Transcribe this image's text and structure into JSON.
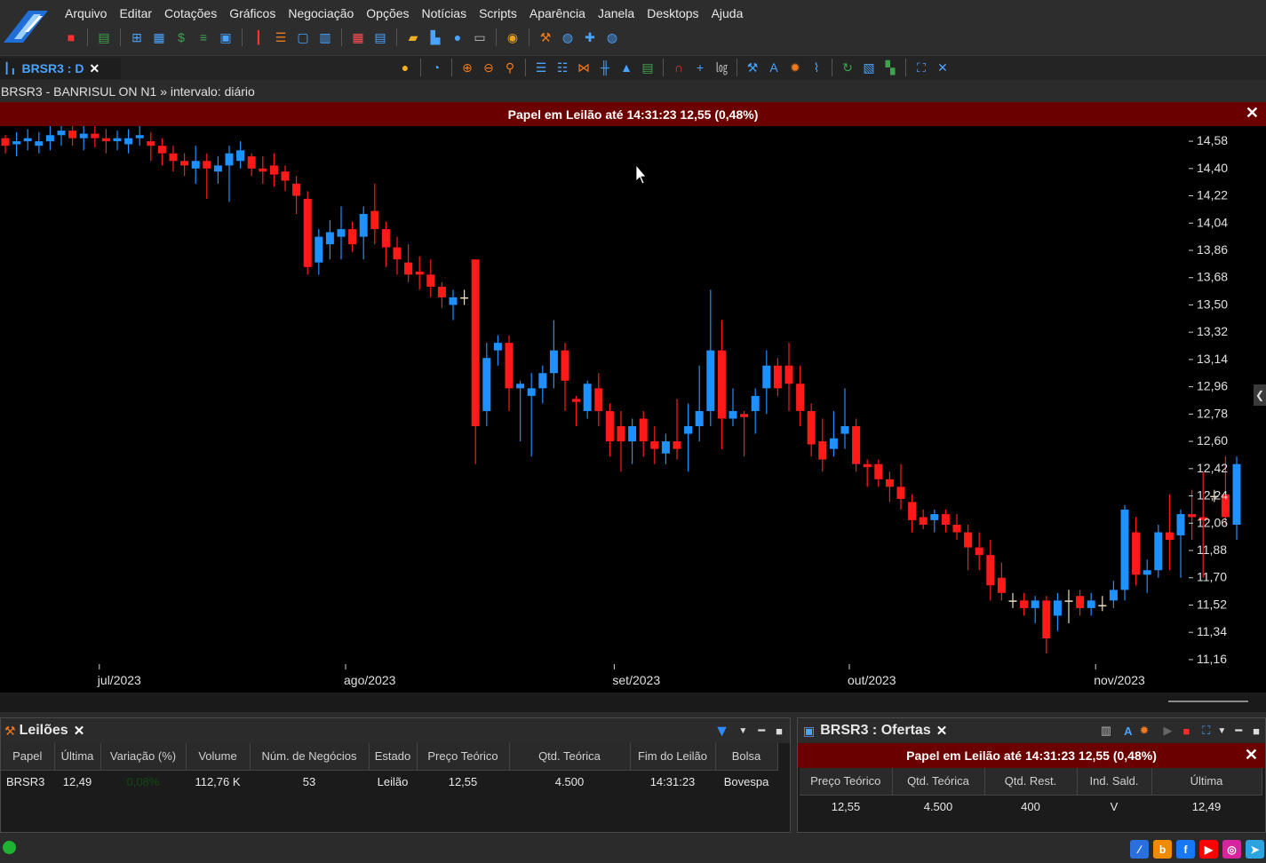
{
  "menu": [
    "Arquivo",
    "Editar",
    "Cotações",
    "Gráficos",
    "Negociação",
    "Opções",
    "Notícias",
    "Scripts",
    "Aparência",
    "Janela",
    "Desktops",
    "Ajuda"
  ],
  "toolbar1_icons": [
    "stop-icon",
    "layout-icon",
    "grid-add-icon",
    "calculator-icon",
    "dollar-icon",
    "ladder-icon",
    "tiles-icon",
    "candles-icon",
    "filter-list-icon",
    "window-icon",
    "list-icon",
    "table-icon",
    "book-icon",
    "folder-icon",
    "bar-chart-icon",
    "person-icon",
    "card-icon",
    "database-stack-icon",
    "hammer-icon",
    "coins-icon",
    "plugin-icon",
    "globe-icon"
  ],
  "toolbar2_icons": [
    "lightbulb-icon",
    "clock-icon",
    "zoom-in-icon",
    "zoom-out-icon",
    "zoom-icon",
    "indicator-list-icon",
    "indicator-add-icon",
    "chart-type-icon",
    "candle-type-icon",
    "shapes-icon",
    "layout-icon",
    "magnet-icon",
    "crosshair-icon",
    "log-scale-icon",
    "wrench-icon",
    "text-a-icon",
    "gear-icon",
    "signals-icon",
    "refresh-icon",
    "image-icon",
    "colors-icon",
    "fit-icon",
    "cross-icon"
  ],
  "chart_tab": {
    "label": "BRSR3 : D",
    "close": "✕"
  },
  "subtitle": "BRSR3 - BANRISUL ON N1 » intervalo: diário",
  "auction_banner": "Papel em Leilão até 14:31:23  12,55 (0,48%)",
  "chart_data": {
    "type": "candlestick",
    "ytick_labels": [
      "14,58",
      "14,40",
      "14,22",
      "14,04",
      "13,86",
      "13,68",
      "13,50",
      "13,32",
      "13,14",
      "12,96",
      "12,78",
      "12,60",
      "12,42",
      "12,24",
      "12,06",
      "11,88",
      "11,70",
      "11,52",
      "11,34",
      "11,16"
    ],
    "ylim": [
      11.06,
      14.68
    ],
    "xtick_labels": [
      "jul/2023",
      "ago/2023",
      "set/2023",
      "out/2023",
      "nov/2023"
    ],
    "xtick_index": [
      8,
      30,
      54,
      75,
      97
    ],
    "up_color": "#1e90ff",
    "down_color": "#ff1a1a",
    "doji_color": "#e8e0c0",
    "candles": [
      [
        14.6,
        14.55,
        14.5,
        14.62
      ],
      [
        14.56,
        14.58,
        14.48,
        14.64
      ],
      [
        14.58,
        14.6,
        14.52,
        14.66
      ],
      [
        14.55,
        14.58,
        14.5,
        14.64
      ],
      [
        14.58,
        14.62,
        14.52,
        14.7
      ],
      [
        14.62,
        14.65,
        14.55,
        14.7
      ],
      [
        14.65,
        14.6,
        14.55,
        14.7
      ],
      [
        14.6,
        14.63,
        14.52,
        14.68
      ],
      [
        14.63,
        14.6,
        14.54,
        14.7
      ],
      [
        14.6,
        14.58,
        14.5,
        14.66
      ],
      [
        14.58,
        14.6,
        14.52,
        14.65
      ],
      [
        14.56,
        14.6,
        14.5,
        14.66
      ],
      [
        14.6,
        14.62,
        14.55,
        14.68
      ],
      [
        14.58,
        14.55,
        14.45,
        14.64
      ],
      [
        14.55,
        14.5,
        14.42,
        14.6
      ],
      [
        14.5,
        14.45,
        14.38,
        14.55
      ],
      [
        14.45,
        14.42,
        14.35,
        14.5
      ],
      [
        14.4,
        14.45,
        14.3,
        14.55
      ],
      [
        14.45,
        14.4,
        14.2,
        14.5
      ],
      [
        14.38,
        14.42,
        14.3,
        14.48
      ],
      [
        14.42,
        14.5,
        14.18,
        14.55
      ],
      [
        14.45,
        14.52,
        14.4,
        14.58
      ],
      [
        14.48,
        14.4,
        14.35,
        14.5
      ],
      [
        14.4,
        14.38,
        14.3,
        14.48
      ],
      [
        14.42,
        14.36,
        14.28,
        14.5
      ],
      [
        14.38,
        14.32,
        14.25,
        14.42
      ],
      [
        14.3,
        14.22,
        14.1,
        14.35
      ],
      [
        14.2,
        13.75,
        13.7,
        14.25
      ],
      [
        13.78,
        13.95,
        13.7,
        14.0
      ],
      [
        13.9,
        13.98,
        13.8,
        14.06
      ],
      [
        13.95,
        14.0,
        13.8,
        14.15
      ],
      [
        14.0,
        13.9,
        13.85,
        14.05
      ],
      [
        13.95,
        14.1,
        13.8,
        14.15
      ],
      [
        14.12,
        14.0,
        13.9,
        14.3
      ],
      [
        14.0,
        13.88,
        13.75,
        14.05
      ],
      [
        13.88,
        13.8,
        13.7,
        13.95
      ],
      [
        13.78,
        13.7,
        13.65,
        13.9
      ],
      [
        13.72,
        13.7,
        13.6,
        13.82
      ],
      [
        13.7,
        13.62,
        13.55,
        13.8
      ],
      [
        13.62,
        13.55,
        13.48,
        13.65
      ],
      [
        13.5,
        13.55,
        13.4,
        13.6
      ],
      [
        13.55,
        13.55,
        13.5,
        13.6
      ],
      [
        13.8,
        12.7,
        12.45,
        13.8
      ],
      [
        12.8,
        13.15,
        12.7,
        13.25
      ],
      [
        13.2,
        13.25,
        13.1,
        13.3
      ],
      [
        13.25,
        12.95,
        12.8,
        13.3
      ],
      [
        12.95,
        12.98,
        12.6,
        13.0
      ],
      [
        12.9,
        12.95,
        12.5,
        13.05
      ],
      [
        12.95,
        13.05,
        12.85,
        13.1
      ],
      [
        13.05,
        13.2,
        12.95,
        13.4
      ],
      [
        13.2,
        13.0,
        12.8,
        13.25
      ],
      [
        12.88,
        12.86,
        12.7,
        12.9
      ],
      [
        12.8,
        12.98,
        12.75,
        13.0
      ],
      [
        12.95,
        12.8,
        12.7,
        13.05
      ],
      [
        12.8,
        12.6,
        12.5,
        12.85
      ],
      [
        12.7,
        12.6,
        12.4,
        12.8
      ],
      [
        12.6,
        12.7,
        12.45,
        12.75
      ],
      [
        12.75,
        12.6,
        12.5,
        12.8
      ],
      [
        12.6,
        12.55,
        12.45,
        12.7
      ],
      [
        12.52,
        12.6,
        12.45,
        12.65
      ],
      [
        12.6,
        12.55,
        12.48,
        12.88
      ],
      [
        12.65,
        12.7,
        12.4,
        12.85
      ],
      [
        12.7,
        12.8,
        12.6,
        13.1
      ],
      [
        12.8,
        13.2,
        12.7,
        13.6
      ],
      [
        13.2,
        12.75,
        12.55,
        13.4
      ],
      [
        12.75,
        12.8,
        12.7,
        12.95
      ],
      [
        12.78,
        12.76,
        12.5,
        12.8
      ],
      [
        12.8,
        12.9,
        12.65,
        12.95
      ],
      [
        12.95,
        13.1,
        12.78,
        13.2
      ],
      [
        13.1,
        12.95,
        12.9,
        13.15
      ],
      [
        13.1,
        12.98,
        12.8,
        13.25
      ],
      [
        12.98,
        12.8,
        12.7,
        13.1
      ],
      [
        12.8,
        12.58,
        12.5,
        12.85
      ],
      [
        12.6,
        12.48,
        12.4,
        12.75
      ],
      [
        12.55,
        12.62,
        12.5,
        12.8
      ],
      [
        12.65,
        12.7,
        12.55,
        12.95
      ],
      [
        12.7,
        12.45,
        12.4,
        12.75
      ],
      [
        12.45,
        12.43,
        12.3,
        12.48
      ],
      [
        12.45,
        12.35,
        12.3,
        12.48
      ],
      [
        12.35,
        12.3,
        12.2,
        12.4
      ],
      [
        12.3,
        12.22,
        12.15,
        12.45
      ],
      [
        12.2,
        12.08,
        12.0,
        12.25
      ],
      [
        12.1,
        12.05,
        12.02,
        12.15
      ],
      [
        12.08,
        12.12,
        12.0,
        12.15
      ],
      [
        12.12,
        12.05,
        12.0,
        12.15
      ],
      [
        12.05,
        12.0,
        11.95,
        12.12
      ],
      [
        12.0,
        11.9,
        11.75,
        12.05
      ],
      [
        11.9,
        11.85,
        11.75,
        12.0
      ],
      [
        11.85,
        11.65,
        11.55,
        11.95
      ],
      [
        11.7,
        11.6,
        11.55,
        11.8
      ],
      [
        11.55,
        11.55,
        11.5,
        11.6
      ],
      [
        11.55,
        11.5,
        11.45,
        11.6
      ],
      [
        11.5,
        11.55,
        11.4,
        11.58
      ],
      [
        11.55,
        11.3,
        11.2,
        11.58
      ],
      [
        11.45,
        11.55,
        11.35,
        11.6
      ],
      [
        11.55,
        11.55,
        11.4,
        11.62
      ],
      [
        11.58,
        11.5,
        11.45,
        11.62
      ],
      [
        11.5,
        11.55,
        11.45,
        11.6
      ],
      [
        11.52,
        11.52,
        11.48,
        11.58
      ],
      [
        11.55,
        11.62,
        11.5,
        11.68
      ],
      [
        11.62,
        12.15,
        11.55,
        12.18
      ],
      [
        12.0,
        11.72,
        11.65,
        12.1
      ],
      [
        11.72,
        11.75,
        11.6,
        11.82
      ],
      [
        11.75,
        12.0,
        11.7,
        12.05
      ],
      [
        12.0,
        11.95,
        11.75,
        12.25
      ],
      [
        11.98,
        12.12,
        11.7,
        12.15
      ],
      [
        12.12,
        12.1,
        11.95,
        12.28
      ],
      [
        12.1,
        12.08,
        11.7,
        12.4
      ],
      [
        12.24,
        12.24,
        12.2,
        12.28
      ],
      [
        12.25,
        12.1,
        12.05,
        12.5
      ],
      [
        12.05,
        12.45,
        11.95,
        12.5
      ]
    ]
  },
  "leiloes": {
    "title": "Leilões",
    "columns": [
      "Papel",
      "Última",
      "Variação (%)",
      "Volume",
      "Núm. de Negócios",
      "Estado",
      "Preço Teórico",
      "Qtd. Teórica",
      "Fim do Leilão",
      "Bolsa"
    ],
    "row": [
      "BRSR3",
      "12,49",
      "0,08%",
      "112,76 K",
      "53",
      "Leilão",
      "12,55",
      "4.500",
      "14:31:23",
      "Bovespa"
    ]
  },
  "ofertas": {
    "title": "BRSR3 : Ofertas",
    "banner": "Papel em Leilão até 14:31:23  12,55 (0,48%)",
    "columns": [
      "Preço Teórico",
      "Qtd. Teórica",
      "Qtd. Rest.",
      "Ind. Sald.",
      "Última"
    ],
    "row": [
      "12,55",
      "4.500",
      "400",
      "V",
      "12,49"
    ]
  },
  "social": [
    {
      "name": "profitchart-icon",
      "glyph": "⁄",
      "color": "#2a6fdb"
    },
    {
      "name": "blog-icon",
      "glyph": "b",
      "color": "#f28a00"
    },
    {
      "name": "facebook-icon",
      "glyph": "f",
      "color": "#1877f2"
    },
    {
      "name": "youtube-icon",
      "glyph": "▶",
      "color": "#ff0000"
    },
    {
      "name": "instagram-icon",
      "glyph": "◎",
      "color": "#d6249f"
    },
    {
      "name": "telegram-icon",
      "glyph": "➤",
      "color": "#2aa3e0"
    }
  ]
}
